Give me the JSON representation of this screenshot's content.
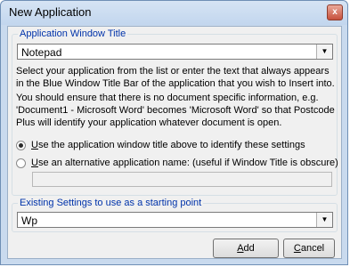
{
  "window": {
    "title": "New Application",
    "close_glyph": "x"
  },
  "app_group": {
    "label": "Application Window Title",
    "combo_value": "Notepad",
    "para1": "Select your application from the list or enter the text that always appears in the Blue Window Title Bar of the application that you wish to Insert into.",
    "para2": "You should ensure that there is no document specific information, e.g. 'Document1 - Microsoft Word' becomes 'Microsoft Word' so that Postcode Plus will identify your application whatever document is open.",
    "radio1": {
      "accel": "U",
      "rest": "se the application window title above to identify these settings",
      "checked": true
    },
    "radio2": {
      "accel": "U",
      "rest": "se an alternative application name: (useful if Window Title is obscure)",
      "checked": false
    },
    "alt_name_value": ""
  },
  "existing_group": {
    "label": "Existing Settings to use as a starting point",
    "combo_value": "Wp"
  },
  "buttons": {
    "add": {
      "accel": "A",
      "rest": "dd"
    },
    "cancel": {
      "accel": "C",
      "rest": "ancel"
    }
  },
  "icons": {
    "dropdown": "chevron-down-icon",
    "close": "close-icon"
  }
}
